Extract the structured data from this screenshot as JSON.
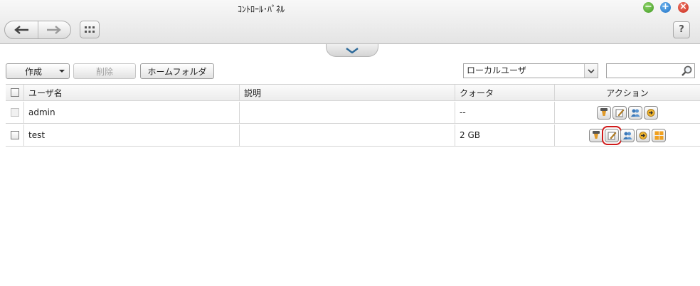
{
  "window": {
    "title": "ｺﾝﾄﾛｰﾙ･ﾊﾟﾈﾙ"
  },
  "toolbar": {
    "create_label": "作成",
    "delete_label": "削除",
    "home_folder_label": "ホームフォルダ",
    "user_type_selected": "ローカルユーザ",
    "search_placeholder": "",
    "help_label": "?"
  },
  "table": {
    "columns": [
      "ユーザ名",
      "説明",
      "クォータ",
      "アクション"
    ],
    "rows": [
      {
        "name": "admin",
        "description": "",
        "quota": "--",
        "actions": [
          "quota-icon",
          "edit-icon",
          "group-icon",
          "password-icon"
        ]
      },
      {
        "name": "test",
        "description": "",
        "quota": "2 GB",
        "actions": [
          "quota-icon",
          "edit-icon",
          "group-icon",
          "password-icon",
          "folder-permission-icon"
        ]
      }
    ]
  },
  "colors": {
    "highlight": "#d01a1a",
    "minimize": "#3f9a21",
    "maximize": "#1c6fc4",
    "close": "#c8281a"
  }
}
